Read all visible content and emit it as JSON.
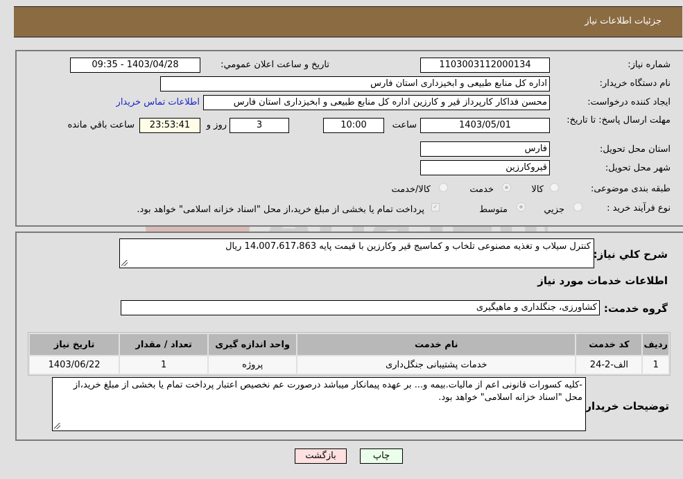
{
  "header": {
    "title": "جزئیات اطلاعات نیاز"
  },
  "fields": {
    "need_number_label": "شماره نیاز:",
    "need_number": "1103003112000134",
    "announce_label": "تاریخ و ساعت اعلان عمومي:",
    "announce_value": "1403/04/28 - 09:35",
    "buyer_org_label": "نام دستگاه خریدار:",
    "buyer_org": "اداره کل منابع طبیعی و ابخیزداری استان فارس",
    "creator_label": "ایجاد کننده درخواست:",
    "creator": "محسن فداکار کارپرداز قیر و کارزین اداره کل منابع طبیعی و ابخیزداری استان فارس",
    "contact_link": "اطلاعات تماس خریدار",
    "deadline_label": "مهلت ارسال پاسخ: تا تاریخ:",
    "deadline_date": "1403/05/01",
    "time_label": "ساعت",
    "deadline_time": "10:00",
    "days_value": "3",
    "days_label": "روز و",
    "remaining_time": "23:53:41",
    "remaining_label": "ساعت باقي مانده",
    "province_label": "استان محل تحویل:",
    "province": "فارس",
    "city_label": "شهر محل تحویل:",
    "city": "قیروکارزین",
    "category_label": "طبقه بندی موضوعی:",
    "category_options": [
      "کالا",
      "خدمت",
      "کالا/خدمت"
    ],
    "category_selected": "خدمت",
    "process_label": "نوع فرآیند خرید :",
    "process_options": [
      "جزيي",
      "متوسط"
    ],
    "process_selected": "متوسط",
    "payment_note": "پرداخت تمام یا بخشی از مبلغ خرید،از محل \"اسناد خزانه اسلامی\" خواهد بود."
  },
  "summary": {
    "label": "شرح کلي نیاز:",
    "text": "کنترل سیلاب و تغذیه مصنوعی تلخاب و کماسیج قیر وکارزین  با قیمت پایه 14،007،617،863 ریال"
  },
  "services": {
    "section_title": "اطلاعات خدمات مورد نیاز",
    "group_label": "گروه خدمت:",
    "group_value": "کشاورزی، جنگلداری و ماهیگیری",
    "columns": [
      "ردیف",
      "کد خدمت",
      "نام خدمت",
      "واحد اندازه گیری",
      "تعداد / مقدار",
      "تاریخ نیاز"
    ],
    "rows": [
      [
        "1",
        "الف-2-24",
        "خدمات پشتیبانی جنگل‌داری",
        "پروژه",
        "1",
        "1403/06/22"
      ]
    ]
  },
  "buyer_notes": {
    "label": "توضیحات خریدار:",
    "text": "-کلیه کسورات قانونی اعم از مالیات.بیمه و... بر عهده پیمانکار میباشد  درصورت عم نخصیص اعتبار پرداخت تمام یا بخشی از مبلغ خرید،از محل \"اسناد خزانه اسلامی\" خواهد بود."
  },
  "buttons": {
    "print": "چاپ",
    "back": "بازگشت"
  },
  "colors": {
    "header_bg": "#8b6c42",
    "print_bg": "#eaffea",
    "back_bg": "#ffe0e0",
    "link": "#1a24c8"
  }
}
